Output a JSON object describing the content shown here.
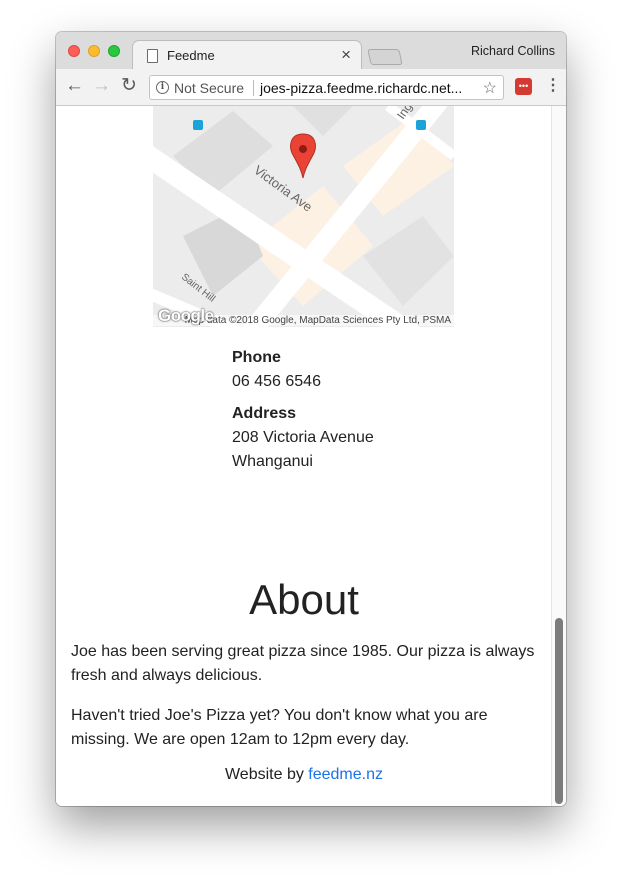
{
  "window": {
    "tab_title": "Feedme",
    "profile_name": "Richard Collins"
  },
  "toolbar": {
    "security_label": "Not Secure",
    "url": "joes-pizza.feedme.richardc.net..."
  },
  "map": {
    "street_label": "Victoria Ave",
    "street_label_2": "Ing",
    "street_label_3": "Saint Hill",
    "attribution": "Map data ©2018 Google, MapData Sciences Pty Ltd, PSMA",
    "logo": "Google"
  },
  "contact": {
    "phone_label": "Phone",
    "phone": "06 456 6546",
    "address_label": "Address",
    "address_line1": "208 Victoria Avenue",
    "address_line2": "Whanganui"
  },
  "about": {
    "heading": "About",
    "paragraph1": "Joe has been serving great pizza since 1985. Our pizza is always fresh and always delicious.",
    "paragraph2": "Haven't tried Joe's Pizza yet? You don't know what you are missing. We are open 12am to 12pm every day."
  },
  "footer": {
    "prefix": "Website by ",
    "link_text": "feedme.nz"
  },
  "colors": {
    "link": "#1a73e8",
    "map_pin": "#ea4335"
  }
}
